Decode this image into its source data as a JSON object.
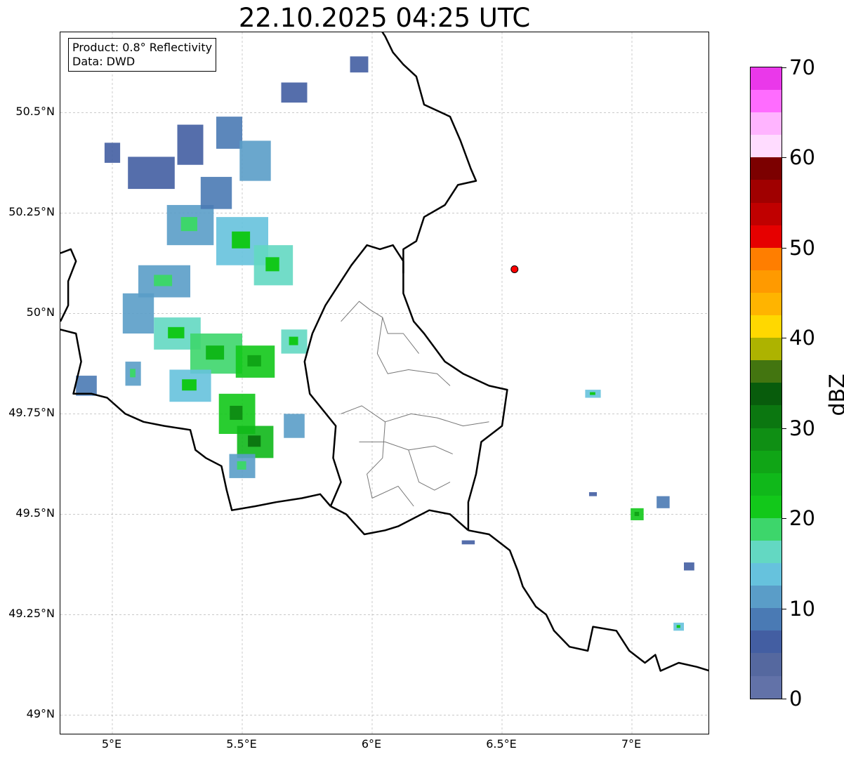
{
  "title": "22.10.2025 04:25 UTC",
  "info_box": {
    "product": "Product: 0.8° Reflectivity",
    "data": "Data: DWD"
  },
  "map": {
    "lon_range": [
      4.8,
      7.3
    ],
    "lat_range": [
      48.95,
      50.7
    ],
    "x_ticks": [
      {
        "lon": 5.0,
        "label": "5°E"
      },
      {
        "lon": 5.5,
        "label": "5.5°E"
      },
      {
        "lon": 6.0,
        "label": "6°E"
      },
      {
        "lon": 6.5,
        "label": "6.5°E"
      },
      {
        "lon": 7.0,
        "label": "7°E"
      }
    ],
    "y_ticks": [
      {
        "lat": 50.5,
        "label": "50.5°N"
      },
      {
        "lat": 50.25,
        "label": "50.25°N"
      },
      {
        "lat": 50.0,
        "label": "50°N"
      },
      {
        "lat": 49.75,
        "label": "49.75°N"
      },
      {
        "lat": 49.5,
        "label": "49.5°N"
      },
      {
        "lat": 49.25,
        "label": "49.25°N"
      },
      {
        "lat": 49.0,
        "label": "49°N"
      }
    ],
    "radar_site": {
      "lon": 6.548,
      "lat": 50.11,
      "color": "#ff0000"
    },
    "grid": true,
    "borders": {
      "belgium_lux_de_fr_lon_lat": [
        [
          4.81,
          50.15
        ],
        [
          4.84,
          50.17
        ],
        [
          4.87,
          50.15
        ],
        [
          4.9,
          50.14
        ],
        [
          4.86,
          50.12
        ],
        [
          4.84,
          50.07
        ],
        [
          4.83,
          50.02
        ],
        [
          4.81,
          49.98
        ]
      ]
    }
  },
  "colorbar": {
    "label": "dBZ",
    "min": 0,
    "max": 70,
    "step": 2.5,
    "ticks": [
      "0",
      "10",
      "20",
      "30",
      "40",
      "50",
      "60",
      "70"
    ],
    "colors": [
      "#6272a8",
      "#55689f",
      "#435ea2",
      "#4a7ab4",
      "#5a9dc8",
      "#66c2dd",
      "#63d8c2",
      "#3dd66b",
      "#12c81a",
      "#10b81a",
      "#10a516",
      "#0f8f14",
      "#0b7710",
      "#085c0c",
      "#437510",
      "#adb300",
      "#ffd800",
      "#ffb400",
      "#ff9a00",
      "#ff7e00",
      "#e60000",
      "#c00000",
      "#a00000",
      "#7c0000",
      "#ffdcff",
      "#ffb4ff",
      "#ff6cff",
      "#ea38ea"
    ]
  },
  "radar_cells": [
    {
      "lon": 5.15,
      "lat": 50.35,
      "w": 0.18,
      "h": 0.08,
      "dbz": 6
    },
    {
      "lon": 5.3,
      "lat": 50.42,
      "w": 0.1,
      "h": 0.1,
      "dbz": 7
    },
    {
      "lon": 5.45,
      "lat": 50.45,
      "w": 0.1,
      "h": 0.08,
      "dbz": 8
    },
    {
      "lon": 5.55,
      "lat": 50.38,
      "w": 0.12,
      "h": 0.1,
      "dbz": 10
    },
    {
      "lon": 5.7,
      "lat": 50.55,
      "w": 0.1,
      "h": 0.05,
      "dbz": 6
    },
    {
      "lon": 5.3,
      "lat": 50.22,
      "w": 0.18,
      "h": 0.1,
      "dbz": 12
    },
    {
      "lon": 5.5,
      "lat": 50.18,
      "w": 0.2,
      "h": 0.12,
      "dbz": 14
    },
    {
      "lon": 5.62,
      "lat": 50.12,
      "w": 0.15,
      "h": 0.1,
      "dbz": 16
    },
    {
      "lon": 5.2,
      "lat": 50.08,
      "w": 0.2,
      "h": 0.08,
      "dbz": 12
    },
    {
      "lon": 5.1,
      "lat": 50.0,
      "w": 0.12,
      "h": 0.1,
      "dbz": 10
    },
    {
      "lon": 5.25,
      "lat": 49.95,
      "w": 0.18,
      "h": 0.08,
      "dbz": 16
    },
    {
      "lon": 5.4,
      "lat": 49.9,
      "w": 0.2,
      "h": 0.1,
      "dbz": 18
    },
    {
      "lon": 5.55,
      "lat": 49.88,
      "w": 0.15,
      "h": 0.08,
      "dbz": 20
    },
    {
      "lon": 5.7,
      "lat": 49.93,
      "w": 0.1,
      "h": 0.06,
      "dbz": 16
    },
    {
      "lon": 5.3,
      "lat": 49.82,
      "w": 0.16,
      "h": 0.08,
      "dbz": 14
    },
    {
      "lon": 5.48,
      "lat": 49.75,
      "w": 0.14,
      "h": 0.1,
      "dbz": 22
    },
    {
      "lon": 5.55,
      "lat": 49.68,
      "w": 0.14,
      "h": 0.08,
      "dbz": 24
    },
    {
      "lon": 5.5,
      "lat": 49.62,
      "w": 0.1,
      "h": 0.06,
      "dbz": 12
    },
    {
      "lon": 5.7,
      "lat": 49.72,
      "w": 0.08,
      "h": 0.06,
      "dbz": 10
    },
    {
      "lon": 4.9,
      "lat": 49.82,
      "w": 0.08,
      "h": 0.05,
      "dbz": 8
    },
    {
      "lon": 5.08,
      "lat": 49.85,
      "w": 0.06,
      "h": 0.06,
      "dbz": 12
    },
    {
      "lon": 5.4,
      "lat": 50.3,
      "w": 0.12,
      "h": 0.08,
      "dbz": 9
    },
    {
      "lon": 5.0,
      "lat": 50.4,
      "w": 0.06,
      "h": 0.05,
      "dbz": 6
    },
    {
      "lon": 5.95,
      "lat": 50.62,
      "w": 0.07,
      "h": 0.04,
      "dbz": 6
    },
    {
      "lon": 6.85,
      "lat": 49.8,
      "w": 0.06,
      "h": 0.02,
      "dbz": 14
    },
    {
      "lon": 7.02,
      "lat": 49.5,
      "w": 0.05,
      "h": 0.03,
      "dbz": 20
    },
    {
      "lon": 7.12,
      "lat": 49.53,
      "w": 0.05,
      "h": 0.03,
      "dbz": 8
    },
    {
      "lon": 7.22,
      "lat": 49.37,
      "w": 0.04,
      "h": 0.02,
      "dbz": 6
    },
    {
      "lon": 7.18,
      "lat": 49.22,
      "w": 0.04,
      "h": 0.02,
      "dbz": 14
    },
    {
      "lon": 6.85,
      "lat": 49.55,
      "w": 0.03,
      "h": 0.01,
      "dbz": 6
    },
    {
      "lon": 6.37,
      "lat": 49.43,
      "w": 0.05,
      "h": 0.01,
      "dbz": 6
    }
  ]
}
